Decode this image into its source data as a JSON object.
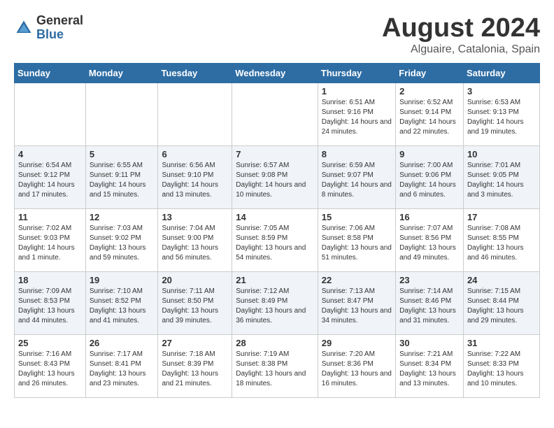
{
  "logo": {
    "general": "General",
    "blue": "Blue"
  },
  "title": "August 2024",
  "subtitle": "Alguaire, Catalonia, Spain",
  "days": [
    "Sunday",
    "Monday",
    "Tuesday",
    "Wednesday",
    "Thursday",
    "Friday",
    "Saturday"
  ],
  "weeks": [
    [
      {
        "date": "",
        "info": ""
      },
      {
        "date": "",
        "info": ""
      },
      {
        "date": "",
        "info": ""
      },
      {
        "date": "",
        "info": ""
      },
      {
        "date": "1",
        "info": "Sunrise: 6:51 AM\nSunset: 9:16 PM\nDaylight: 14 hours\nand 24 minutes."
      },
      {
        "date": "2",
        "info": "Sunrise: 6:52 AM\nSunset: 9:14 PM\nDaylight: 14 hours\nand 22 minutes."
      },
      {
        "date": "3",
        "info": "Sunrise: 6:53 AM\nSunset: 9:13 PM\nDaylight: 14 hours\nand 19 minutes."
      }
    ],
    [
      {
        "date": "4",
        "info": "Sunrise: 6:54 AM\nSunset: 9:12 PM\nDaylight: 14 hours\nand 17 minutes."
      },
      {
        "date": "5",
        "info": "Sunrise: 6:55 AM\nSunset: 9:11 PM\nDaylight: 14 hours\nand 15 minutes."
      },
      {
        "date": "6",
        "info": "Sunrise: 6:56 AM\nSunset: 9:10 PM\nDaylight: 14 hours\nand 13 minutes."
      },
      {
        "date": "7",
        "info": "Sunrise: 6:57 AM\nSunset: 9:08 PM\nDaylight: 14 hours\nand 10 minutes."
      },
      {
        "date": "8",
        "info": "Sunrise: 6:59 AM\nSunset: 9:07 PM\nDaylight: 14 hours\nand 8 minutes."
      },
      {
        "date": "9",
        "info": "Sunrise: 7:00 AM\nSunset: 9:06 PM\nDaylight: 14 hours\nand 6 minutes."
      },
      {
        "date": "10",
        "info": "Sunrise: 7:01 AM\nSunset: 9:05 PM\nDaylight: 14 hours\nand 3 minutes."
      }
    ],
    [
      {
        "date": "11",
        "info": "Sunrise: 7:02 AM\nSunset: 9:03 PM\nDaylight: 14 hours\nand 1 minute."
      },
      {
        "date": "12",
        "info": "Sunrise: 7:03 AM\nSunset: 9:02 PM\nDaylight: 13 hours\nand 59 minutes."
      },
      {
        "date": "13",
        "info": "Sunrise: 7:04 AM\nSunset: 9:00 PM\nDaylight: 13 hours\nand 56 minutes."
      },
      {
        "date": "14",
        "info": "Sunrise: 7:05 AM\nSunset: 8:59 PM\nDaylight: 13 hours\nand 54 minutes."
      },
      {
        "date": "15",
        "info": "Sunrise: 7:06 AM\nSunset: 8:58 PM\nDaylight: 13 hours\nand 51 minutes."
      },
      {
        "date": "16",
        "info": "Sunrise: 7:07 AM\nSunset: 8:56 PM\nDaylight: 13 hours\nand 49 minutes."
      },
      {
        "date": "17",
        "info": "Sunrise: 7:08 AM\nSunset: 8:55 PM\nDaylight: 13 hours\nand 46 minutes."
      }
    ],
    [
      {
        "date": "18",
        "info": "Sunrise: 7:09 AM\nSunset: 8:53 PM\nDaylight: 13 hours\nand 44 minutes."
      },
      {
        "date": "19",
        "info": "Sunrise: 7:10 AM\nSunset: 8:52 PM\nDaylight: 13 hours\nand 41 minutes."
      },
      {
        "date": "20",
        "info": "Sunrise: 7:11 AM\nSunset: 8:50 PM\nDaylight: 13 hours\nand 39 minutes."
      },
      {
        "date": "21",
        "info": "Sunrise: 7:12 AM\nSunset: 8:49 PM\nDaylight: 13 hours\nand 36 minutes."
      },
      {
        "date": "22",
        "info": "Sunrise: 7:13 AM\nSunset: 8:47 PM\nDaylight: 13 hours\nand 34 minutes."
      },
      {
        "date": "23",
        "info": "Sunrise: 7:14 AM\nSunset: 8:46 PM\nDaylight: 13 hours\nand 31 minutes."
      },
      {
        "date": "24",
        "info": "Sunrise: 7:15 AM\nSunset: 8:44 PM\nDaylight: 13 hours\nand 29 minutes."
      }
    ],
    [
      {
        "date": "25",
        "info": "Sunrise: 7:16 AM\nSunset: 8:43 PM\nDaylight: 13 hours\nand 26 minutes."
      },
      {
        "date": "26",
        "info": "Sunrise: 7:17 AM\nSunset: 8:41 PM\nDaylight: 13 hours\nand 23 minutes."
      },
      {
        "date": "27",
        "info": "Sunrise: 7:18 AM\nSunset: 8:39 PM\nDaylight: 13 hours\nand 21 minutes."
      },
      {
        "date": "28",
        "info": "Sunrise: 7:19 AM\nSunset: 8:38 PM\nDaylight: 13 hours\nand 18 minutes."
      },
      {
        "date": "29",
        "info": "Sunrise: 7:20 AM\nSunset: 8:36 PM\nDaylight: 13 hours\nand 16 minutes."
      },
      {
        "date": "30",
        "info": "Sunrise: 7:21 AM\nSunset: 8:34 PM\nDaylight: 13 hours\nand 13 minutes."
      },
      {
        "date": "31",
        "info": "Sunrise: 7:22 AM\nSunset: 8:33 PM\nDaylight: 13 hours\nand 10 minutes."
      }
    ]
  ]
}
